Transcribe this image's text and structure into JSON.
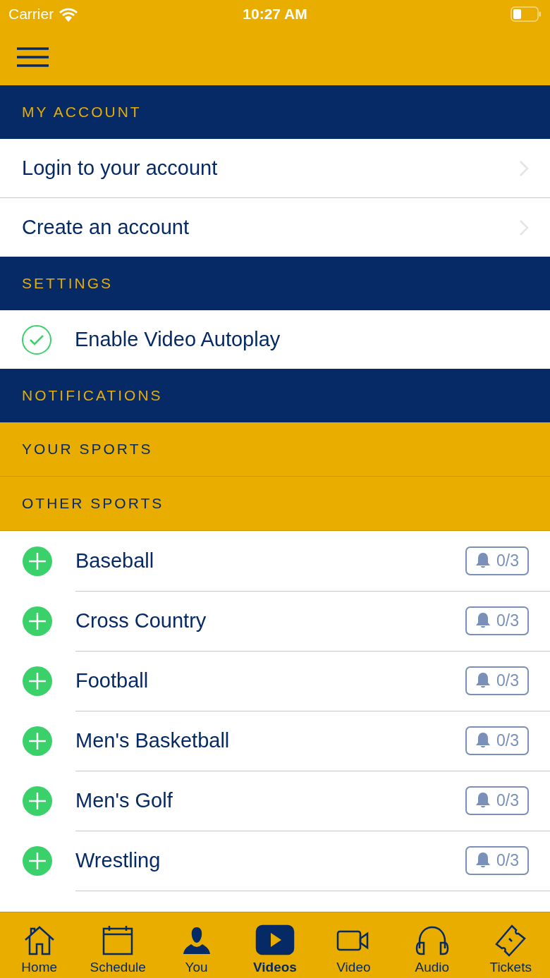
{
  "status_bar": {
    "carrier": "Carrier",
    "time": "10:27 AM"
  },
  "account": {
    "title": "MY ACCOUNT",
    "items": [
      {
        "label": "Login to your account"
      },
      {
        "label": "Create an account"
      }
    ]
  },
  "settings": {
    "title": "SETTINGS",
    "items": [
      {
        "label": "Enable Video Autoplay",
        "checked": true
      }
    ]
  },
  "notifications": {
    "title": "NOTIFICATIONS",
    "groups": [
      {
        "title": "YOUR SPORTS"
      },
      {
        "title": "OTHER SPORTS"
      }
    ],
    "sports": [
      {
        "name": "Baseball",
        "count": "0/3"
      },
      {
        "name": "Cross Country",
        "count": "0/3"
      },
      {
        "name": "Football",
        "count": "0/3"
      },
      {
        "name": "Men's Basketball",
        "count": "0/3"
      },
      {
        "name": "Men's Golf",
        "count": "0/3"
      },
      {
        "name": "Wrestling",
        "count": "0/3"
      }
    ]
  },
  "tab_bar": [
    {
      "label": "Home",
      "selected": false
    },
    {
      "label": "Schedule",
      "selected": false
    },
    {
      "label": "You",
      "selected": false
    },
    {
      "label": "Videos",
      "selected": true
    },
    {
      "label": "Video",
      "selected": false
    },
    {
      "label": "Audio",
      "selected": false
    },
    {
      "label": "Tickets",
      "selected": false
    }
  ]
}
